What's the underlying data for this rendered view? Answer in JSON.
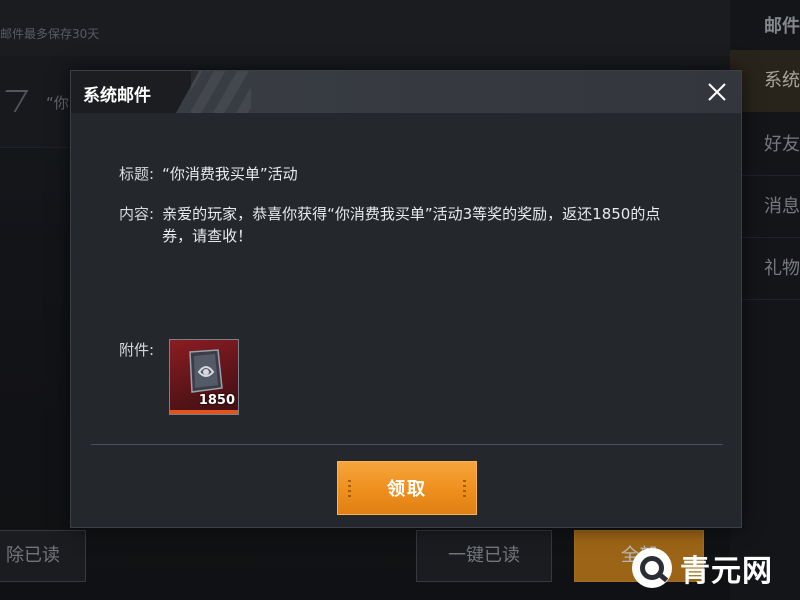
{
  "background": {
    "note": "邮件最多保存30天",
    "row_text": "“你",
    "panel_title": "邮件",
    "tabs": [
      {
        "label": "系统"
      },
      {
        "label": "好友"
      },
      {
        "label": "消息"
      },
      {
        "label": "礼物"
      }
    ],
    "buttons": {
      "delete_read": "除已读",
      "mark_all_read": "一键已读",
      "claim_all": "全部"
    }
  },
  "watermark": {
    "text": "青元网",
    "icon": "q-logo-icon"
  },
  "modal": {
    "title": "系统邮件",
    "close_icon": "close-icon",
    "subject_label": "标题:",
    "subject_value": "“你消费我买单”活动",
    "content_label": "内容:",
    "content_value": "亲爱的玩家，恭喜你获得“你消费我买单”活动3等奖的奖励，返还1850的点券，请查收！",
    "attachment_label": "附件:",
    "attachment": {
      "icon": "coupon-icon",
      "quantity": "1850"
    },
    "claim_button": "领取"
  },
  "colors": {
    "accent_orange": "#ee8f1d",
    "item_red": "#8b1d22",
    "modal_bg": "#24272c"
  }
}
